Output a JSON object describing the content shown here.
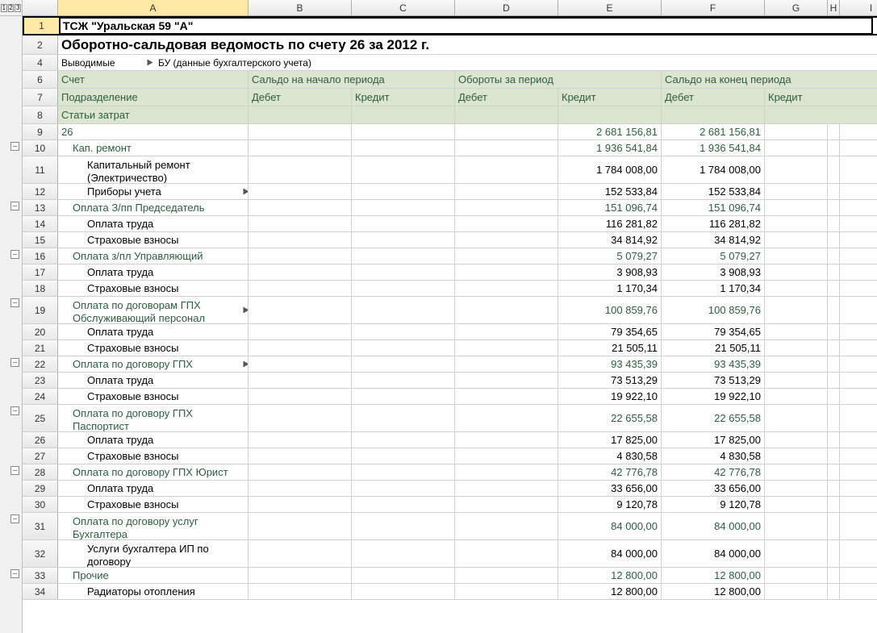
{
  "outline_levels": [
    "1",
    "2",
    "3"
  ],
  "columns": [
    "A",
    "B",
    "C",
    "D",
    "E",
    "F",
    "G",
    "H",
    "I"
  ],
  "selected_col": "A",
  "row_title": {
    "num": "1",
    "text": "ТСЖ \"Уральская 59 \"А\""
  },
  "row_subtitle": {
    "num": "2",
    "text": "Оборотно-сальдовая ведомость по счету 26 за 2012 г."
  },
  "row_filters": {
    "num": "4",
    "label": "Выводимые",
    "value": "БУ (данные бухгалтерского учета)"
  },
  "header_rows": [
    {
      "num": "6",
      "cells": [
        "Счет",
        "Сальдо на начало периода",
        "",
        "Обороты за период",
        "",
        "Сальдо на конец периода",
        ""
      ]
    },
    {
      "num": "7",
      "cells": [
        "Подразделение",
        "Дебет",
        "Кредит",
        "Дебет",
        "Кредит",
        "Дебет",
        "Кредит"
      ]
    },
    {
      "num": "8",
      "cells": [
        "Статьи затрат",
        "",
        "",
        "",
        "",
        "",
        ""
      ]
    }
  ],
  "data_rows": [
    {
      "num": "9",
      "label": "26",
      "indent": 0,
      "green": true,
      "E": "2 681 156,81",
      "F": "2 681 156,81",
      "tall": false
    },
    {
      "num": "10",
      "label": "Кап. ремонт",
      "indent": 1,
      "green": true,
      "E": "1 936 541,84",
      "F": "1 936 541,84"
    },
    {
      "num": "11",
      "label": "Капитальный ремонт (Электричество)",
      "indent": 2,
      "wrap": true,
      "E": "1 784 008,00",
      "F": "1 784 008,00",
      "tall": true
    },
    {
      "num": "12",
      "label": "Приборы учета",
      "indent": 2,
      "tri": true,
      "E": "152 533,84",
      "F": "152 533,84"
    },
    {
      "num": "13",
      "label": "Оплата З/пп Председатель",
      "indent": 1,
      "green": true,
      "E": "151 096,74",
      "F": "151 096,74"
    },
    {
      "num": "14",
      "label": "Оплата труда",
      "indent": 2,
      "E": "116 281,82",
      "F": "116 281,82"
    },
    {
      "num": "15",
      "label": "Страховые взносы",
      "indent": 2,
      "E": "34 814,92",
      "F": "34 814,92"
    },
    {
      "num": "16",
      "label": "Оплата з/пл Управляющий",
      "indent": 1,
      "green": true,
      "E": "5 079,27",
      "F": "5 079,27"
    },
    {
      "num": "17",
      "label": "Оплата труда",
      "indent": 2,
      "E": "3 908,93",
      "F": "3 908,93"
    },
    {
      "num": "18",
      "label": "Страховые взносы",
      "indent": 2,
      "E": "1 170,34",
      "F": "1 170,34"
    },
    {
      "num": "19",
      "label": "Оплата по договорам ГПХ Обслуживающий персонал",
      "indent": 1,
      "green": true,
      "wrap": true,
      "tri": true,
      "E": "100 859,76",
      "F": "100 859,76",
      "tall": true
    },
    {
      "num": "20",
      "label": "Оплата труда",
      "indent": 2,
      "E": "79 354,65",
      "F": "79 354,65"
    },
    {
      "num": "21",
      "label": "Страховые взносы",
      "indent": 2,
      "E": "21 505,11",
      "F": "21 505,11"
    },
    {
      "num": "22",
      "label": "Оплата по договору ГПХ",
      "indent": 1,
      "green": true,
      "tri": true,
      "E": "93 435,39",
      "F": "93 435,39"
    },
    {
      "num": "23",
      "label": "Оплата труда",
      "indent": 2,
      "E": "73 513,29",
      "F": "73 513,29"
    },
    {
      "num": "24",
      "label": "Страховые взносы",
      "indent": 2,
      "E": "19 922,10",
      "F": "19 922,10"
    },
    {
      "num": "25",
      "label": "Оплата по договору ГПХ Паспортист",
      "indent": 1,
      "green": true,
      "wrap": true,
      "E": "22 655,58",
      "F": "22 655,58",
      "tall": true
    },
    {
      "num": "26",
      "label": "Оплата труда",
      "indent": 2,
      "E": "17 825,00",
      "F": "17 825,00"
    },
    {
      "num": "27",
      "label": "Страховые взносы",
      "indent": 2,
      "E": "4 830,58",
      "F": "4 830,58"
    },
    {
      "num": "28",
      "label": "Оплата по договору ГПХ Юрист",
      "indent": 1,
      "green": true,
      "E": "42 776,78",
      "F": "42 776,78"
    },
    {
      "num": "29",
      "label": "Оплата труда",
      "indent": 2,
      "E": "33 656,00",
      "F": "33 656,00"
    },
    {
      "num": "30",
      "label": "Страховые взносы",
      "indent": 2,
      "E": "9 120,78",
      "F": "9 120,78"
    },
    {
      "num": "31",
      "label": "Оплата по договору услуг Бухгалтера",
      "indent": 1,
      "green": true,
      "wrap": true,
      "E": "84 000,00",
      "F": "84 000,00",
      "tall": true
    },
    {
      "num": "32",
      "label": "Услуги бухгалтера ИП по договору",
      "indent": 2,
      "wrap": true,
      "E": "84 000,00",
      "F": "84 000,00",
      "tall": true
    },
    {
      "num": "33",
      "label": "Прочие",
      "indent": 1,
      "green": true,
      "E": "12 800,00",
      "F": "12 800,00"
    },
    {
      "num": "34",
      "label": "Радиаторы отопления",
      "indent": 2,
      "E": "12 800,00",
      "F": "12 800,00"
    }
  ]
}
